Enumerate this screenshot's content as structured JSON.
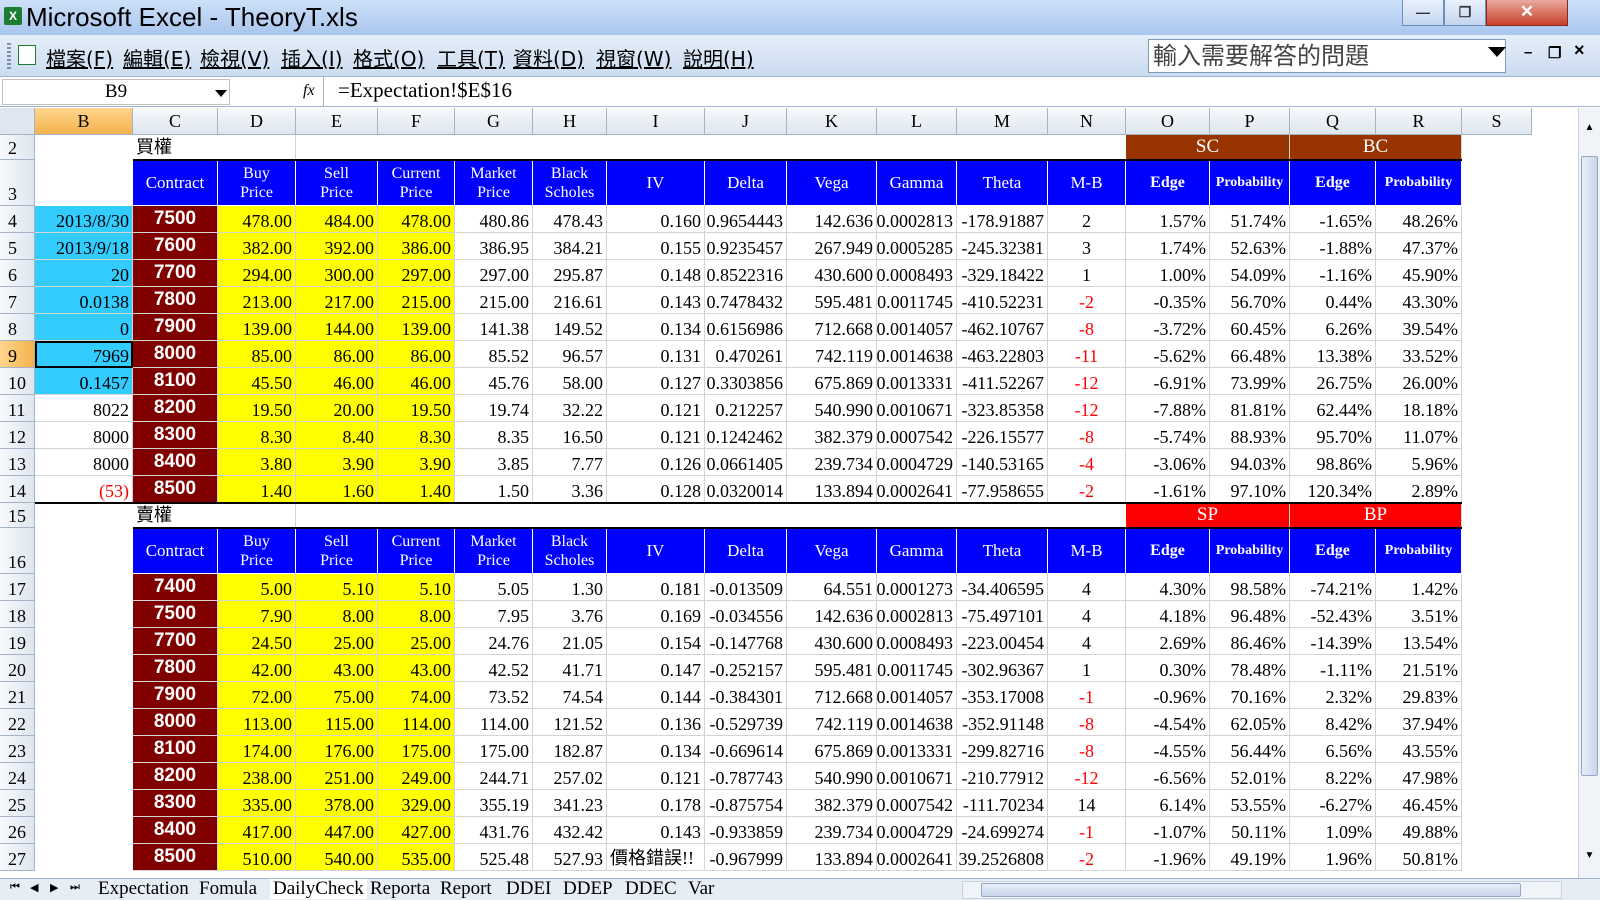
{
  "window": {
    "title": "Microsoft Excel - TheoryT.xls",
    "minimize": "—",
    "restore": "❐",
    "close": "✕",
    "app_icon": "X"
  },
  "menu": {
    "items": [
      "檔案(F)",
      "編輯(E)",
      "檢視(V)",
      "插入(I)",
      "格式(O)",
      "工具(T)",
      "資料(D)",
      "視窗(W)",
      "說明(H)"
    ],
    "ask_placeholder": "輸入需要解答的問題",
    "mdi_min": "–",
    "mdi_restore": "❐",
    "mdi_close": "×"
  },
  "formula_bar": {
    "name_box": "B9",
    "fx": "fx",
    "formula": "=Expectation!$E$16"
  },
  "columns": [
    "B",
    "C",
    "D",
    "E",
    "F",
    "G",
    "H",
    "I",
    "J",
    "K",
    "L",
    "M",
    "N",
    "O",
    "P",
    "Q",
    "R",
    "S"
  ],
  "selected_column": "B",
  "rows": [
    "2",
    "3",
    "4",
    "5",
    "6",
    "7",
    "8",
    "9",
    "10",
    "11",
    "12",
    "13",
    "14",
    "15",
    "16",
    "17",
    "18",
    "19",
    "20",
    "21",
    "22",
    "23",
    "24",
    "25",
    "26",
    "27"
  ],
  "selected_row": "9",
  "section_call": "買權",
  "section_put": "賣權",
  "groups": {
    "sc": "SC",
    "bc": "BC",
    "sp": "SP",
    "bp": "BP"
  },
  "headers": {
    "contract": "Contract",
    "buy": [
      "Buy",
      "Price"
    ],
    "sell": [
      "Sell",
      "Price"
    ],
    "current": [
      "Current",
      "Price"
    ],
    "market": [
      "Market",
      "Price"
    ],
    "black": [
      "Black",
      "Scholes"
    ],
    "iv": "IV",
    "delta": "Delta",
    "vega": "Vega",
    "gamma": "Gamma",
    "theta": "Theta",
    "mb": "M-B",
    "edge1": "Edge",
    "prob1": "Probability",
    "edge2": "Edge",
    "prob2": "Probability"
  },
  "call_b_values": [
    "2013/8/30",
    "2013/9/18",
    "20",
    "0.0138",
    "0",
    "7969",
    "0.1457",
    "8022",
    "8000",
    "8000",
    "(53)"
  ],
  "call_rows": [
    [
      "7500",
      "478.00",
      "484.00",
      "478.00",
      "480.86",
      "478.43",
      "0.160",
      "0.9654443",
      "142.636",
      "0.0002813",
      "-178.91887",
      "2",
      "1.57%",
      "51.74%",
      "-1.65%",
      "48.26%"
    ],
    [
      "7600",
      "382.00",
      "392.00",
      "386.00",
      "386.95",
      "384.21",
      "0.155",
      "0.9235457",
      "267.949",
      "0.0005285",
      "-245.32381",
      "3",
      "1.74%",
      "52.63%",
      "-1.88%",
      "47.37%"
    ],
    [
      "7700",
      "294.00",
      "300.00",
      "297.00",
      "297.00",
      "295.87",
      "0.148",
      "0.8522316",
      "430.600",
      "0.0008493",
      "-329.18422",
      "1",
      "1.00%",
      "54.09%",
      "-1.16%",
      "45.90%"
    ],
    [
      "7800",
      "213.00",
      "217.00",
      "215.00",
      "215.00",
      "216.61",
      "0.143",
      "0.7478432",
      "595.481",
      "0.0011745",
      "-410.52231",
      "-2",
      "-0.35%",
      "56.70%",
      "0.44%",
      "43.30%"
    ],
    [
      "7900",
      "139.00",
      "144.00",
      "139.00",
      "141.38",
      "149.52",
      "0.134",
      "0.6156986",
      "712.668",
      "0.0014057",
      "-462.10767",
      "-8",
      "-3.72%",
      "60.45%",
      "6.26%",
      "39.54%"
    ],
    [
      "8000",
      "85.00",
      "86.00",
      "86.00",
      "85.52",
      "96.57",
      "0.131",
      "0.470261",
      "742.119",
      "0.0014638",
      "-463.22803",
      "-11",
      "-5.62%",
      "66.48%",
      "13.38%",
      "33.52%"
    ],
    [
      "8100",
      "45.50",
      "46.00",
      "46.00",
      "45.76",
      "58.00",
      "0.127",
      "0.3303856",
      "675.869",
      "0.0013331",
      "-411.52267",
      "-12",
      "-6.91%",
      "73.99%",
      "26.75%",
      "26.00%"
    ],
    [
      "8200",
      "19.50",
      "20.00",
      "19.50",
      "19.74",
      "32.22",
      "0.121",
      "0.212257",
      "540.990",
      "0.0010671",
      "-323.85358",
      "-12",
      "-7.88%",
      "81.81%",
      "62.44%",
      "18.18%"
    ],
    [
      "8300",
      "8.30",
      "8.40",
      "8.30",
      "8.35",
      "16.50",
      "0.121",
      "0.1242462",
      "382.379",
      "0.0007542",
      "-226.15577",
      "-8",
      "-5.74%",
      "88.93%",
      "95.70%",
      "11.07%"
    ],
    [
      "8400",
      "3.80",
      "3.90",
      "3.90",
      "3.85",
      "7.77",
      "0.126",
      "0.0661405",
      "239.734",
      "0.0004729",
      "-140.53165",
      "-4",
      "-3.06%",
      "94.03%",
      "98.86%",
      "5.96%"
    ],
    [
      "8500",
      "1.40",
      "1.60",
      "1.40",
      "1.50",
      "3.36",
      "0.128",
      "0.0320014",
      "133.894",
      "0.0002641",
      "-77.958655",
      "-2",
      "-1.61%",
      "97.10%",
      "120.34%",
      "2.89%"
    ]
  ],
  "put_rows": [
    [
      "7400",
      "5.00",
      "5.10",
      "5.10",
      "5.05",
      "1.30",
      "0.181",
      "-0.013509",
      "64.551",
      "0.0001273",
      "-34.406595",
      "4",
      "4.30%",
      "98.58%",
      "-74.21%",
      "1.42%"
    ],
    [
      "7500",
      "7.90",
      "8.00",
      "8.00",
      "7.95",
      "3.76",
      "0.169",
      "-0.034556",
      "142.636",
      "0.0002813",
      "-75.497101",
      "4",
      "4.18%",
      "96.48%",
      "-52.43%",
      "3.51%"
    ],
    [
      "7700",
      "24.50",
      "25.00",
      "25.00",
      "24.76",
      "21.05",
      "0.154",
      "-0.147768",
      "430.600",
      "0.0008493",
      "-223.00454",
      "4",
      "2.69%",
      "86.46%",
      "-14.39%",
      "13.54%"
    ],
    [
      "7800",
      "42.00",
      "43.00",
      "43.00",
      "42.52",
      "41.71",
      "0.147",
      "-0.252157",
      "595.481",
      "0.0011745",
      "-302.96367",
      "1",
      "0.30%",
      "78.48%",
      "-1.11%",
      "21.51%"
    ],
    [
      "7900",
      "72.00",
      "75.00",
      "74.00",
      "73.52",
      "74.54",
      "0.144",
      "-0.384301",
      "712.668",
      "0.0014057",
      "-353.17008",
      "-1",
      "-0.96%",
      "70.16%",
      "2.32%",
      "29.83%"
    ],
    [
      "8000",
      "113.00",
      "115.00",
      "114.00",
      "114.00",
      "121.52",
      "0.136",
      "-0.529739",
      "742.119",
      "0.0014638",
      "-352.91148",
      "-8",
      "-4.54%",
      "62.05%",
      "8.42%",
      "37.94%"
    ],
    [
      "8100",
      "174.00",
      "176.00",
      "175.00",
      "175.00",
      "182.87",
      "0.134",
      "-0.669614",
      "675.869",
      "0.0013331",
      "-299.82716",
      "-8",
      "-4.55%",
      "56.44%",
      "6.56%",
      "43.55%"
    ],
    [
      "8200",
      "238.00",
      "251.00",
      "249.00",
      "244.71",
      "257.02",
      "0.121",
      "-0.787743",
      "540.990",
      "0.0010671",
      "-210.77912",
      "-12",
      "-6.56%",
      "52.01%",
      "8.22%",
      "47.98%"
    ],
    [
      "8300",
      "335.00",
      "378.00",
      "329.00",
      "355.19",
      "341.23",
      "0.178",
      "-0.875754",
      "382.379",
      "0.0007542",
      "-111.70234",
      "14",
      "6.14%",
      "53.55%",
      "-6.27%",
      "46.45%"
    ],
    [
      "8400",
      "417.00",
      "447.00",
      "427.00",
      "431.76",
      "432.42",
      "0.143",
      "-0.933859",
      "239.734",
      "0.0004729",
      "-24.699274",
      "-1",
      "-1.07%",
      "50.11%",
      "1.09%",
      "49.88%"
    ],
    [
      "8500",
      "510.00",
      "540.00",
      "535.00",
      "525.48",
      "527.93",
      "價格錯誤!!",
      "-0.967999",
      "133.894",
      "0.0002641",
      "39.2526808",
      "-2",
      "-1.96%",
      "49.19%",
      "1.96%",
      "50.81%"
    ]
  ],
  "sheet_tabs": [
    "Expectation",
    "Fomula",
    "DailyCheck",
    "Reporta",
    "Report",
    "DDEI",
    "DDEP",
    "DDEC",
    "Var"
  ],
  "active_tab": "DailyCheck",
  "nav_buttons": [
    "⏮",
    "◀",
    "▶",
    "⏭"
  ],
  "colors": {
    "header_blue": "#0000ff",
    "contract_maroon": "#800000",
    "price_yellow": "#ffff00",
    "input_cyan": "#33ccff",
    "sc_brown": "#993300",
    "sp_red": "#ff0000"
  }
}
